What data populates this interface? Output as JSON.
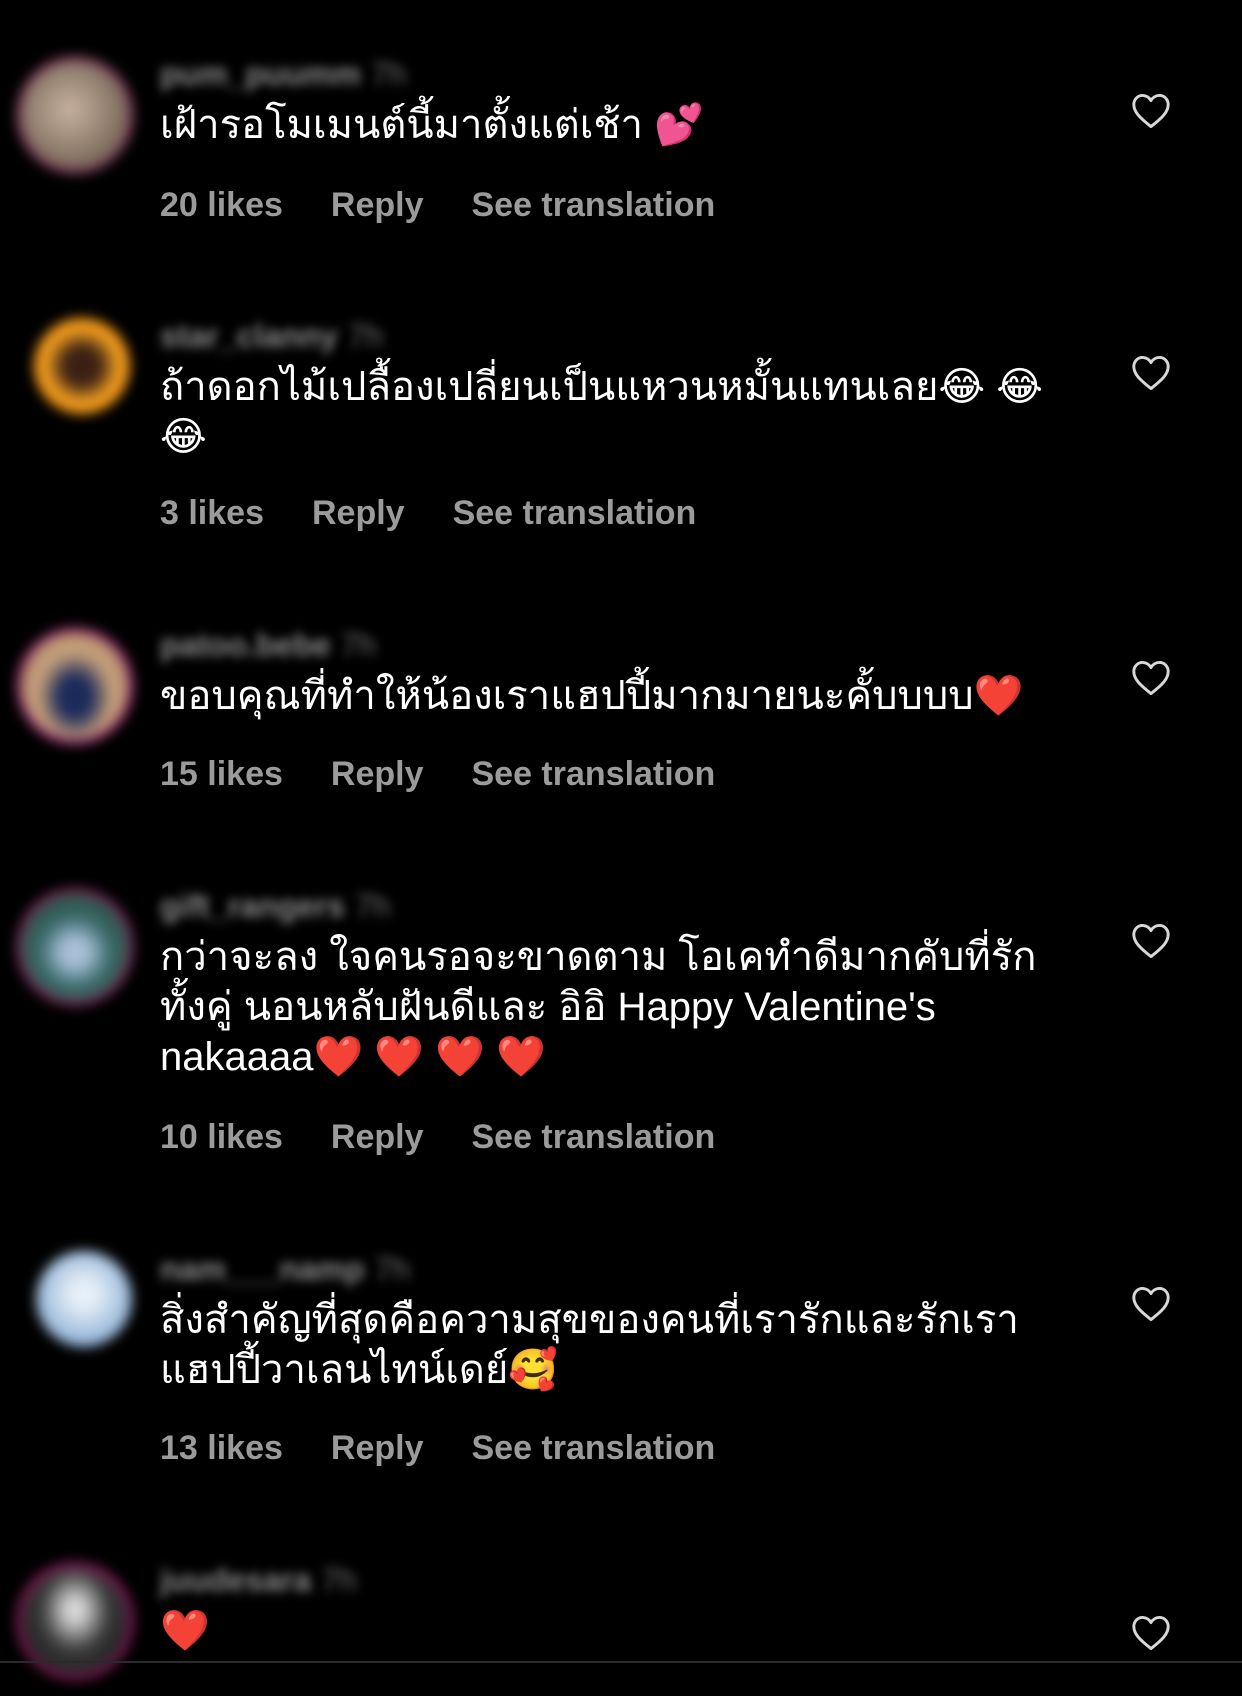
{
  "comments": [
    {
      "username": "pum_puumm",
      "time": "7h",
      "text": "เฝ้ารอโมเมนต์นี้มาตั้งแต่เช้า 💕",
      "likes": "20 likes",
      "reply": "Reply",
      "see_translation": "See translation",
      "avatar_colors": [
        "#7b3a5a",
        "#a98b7a"
      ]
    },
    {
      "username": "star_clanny",
      "time": "7h",
      "text": "ถ้าดอกไม้เปลื้องเปลี่ยนเป็นแหวนหมั้นแทนเลย😂 😂 😂",
      "likes": "3 likes",
      "reply": "Reply",
      "see_translation": "See translation",
      "avatar_colors": [
        "#f39a1a",
        "#4a2a1a"
      ]
    },
    {
      "username": "patoo.bebe",
      "time": "7h",
      "text": "ขอบคุณที่ทำให้น้องเราแฮปปี้มากมายนะคั้บบบบ❤️",
      "likes": "15 likes",
      "reply": "Reply",
      "see_translation": "See translation",
      "avatar_colors": [
        "#8a2a6a",
        "#c9a27a"
      ]
    },
    {
      "username": "gift_rangers",
      "time": "7h",
      "text": "กว่าจะลง ใจคนรอจะขาดตาม โอเคทำดีมากคับที่รักทั้งคู่ นอนหลับฝันดีและ อิอิ Happy Valentine's nakaaaa❤️ ❤️ ❤️ ❤️",
      "likes": "10 likes",
      "reply": "Reply",
      "see_translation": "See translation",
      "avatar_colors": [
        "#7a2a5a",
        "#5a8a9a"
      ]
    },
    {
      "username": "nam___namp",
      "time": "7h",
      "text": "สิ่งสำคัญที่สุดคือความสุขของคนที่เรารักและรักเราแฮปปี้วาเลนไทน์เดย์🥰",
      "likes": "13 likes",
      "reply": "Reply",
      "see_translation": "See translation",
      "avatar_colors": [
        "#8ab4d8",
        "#d8e6f0"
      ]
    },
    {
      "username": "juudesara",
      "time": "7h",
      "text": "❤️",
      "likes": "",
      "reply": "",
      "see_translation": "",
      "avatar_colors": [
        "#8a1a5a",
        "#3a3a3a"
      ]
    }
  ],
  "icons": {
    "like": "heart-outline-icon"
  },
  "colors": {
    "background": "#000000",
    "text": "#ffffff",
    "muted": "#9b9b9b",
    "heart_emoji": "#e0245e"
  }
}
